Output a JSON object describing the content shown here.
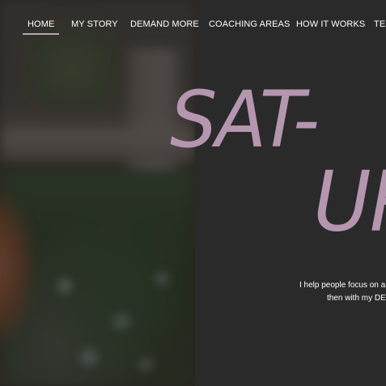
{
  "nav": {
    "items": [
      {
        "label": "HOME",
        "active": true
      },
      {
        "label": "MY STORY",
        "active": false
      },
      {
        "label": "DEMAND MORE",
        "active": false
      },
      {
        "label": "COACHING AREAS",
        "active": false
      },
      {
        "label": "HOW IT WORKS",
        "active": false
      },
      {
        "label": "TES",
        "active": false
      }
    ]
  },
  "hero": {
    "headline_line1": "SAT-",
    "headline_line2": "UR",
    "intro_line1": "I help people focus on ar",
    "intro_line2": "then with my DEI"
  },
  "colors": {
    "accent": "#b596af",
    "panel_bg": "#2a2a2a",
    "nav_text": "#ffffff",
    "nav_underline": "#b4a6b1"
  }
}
